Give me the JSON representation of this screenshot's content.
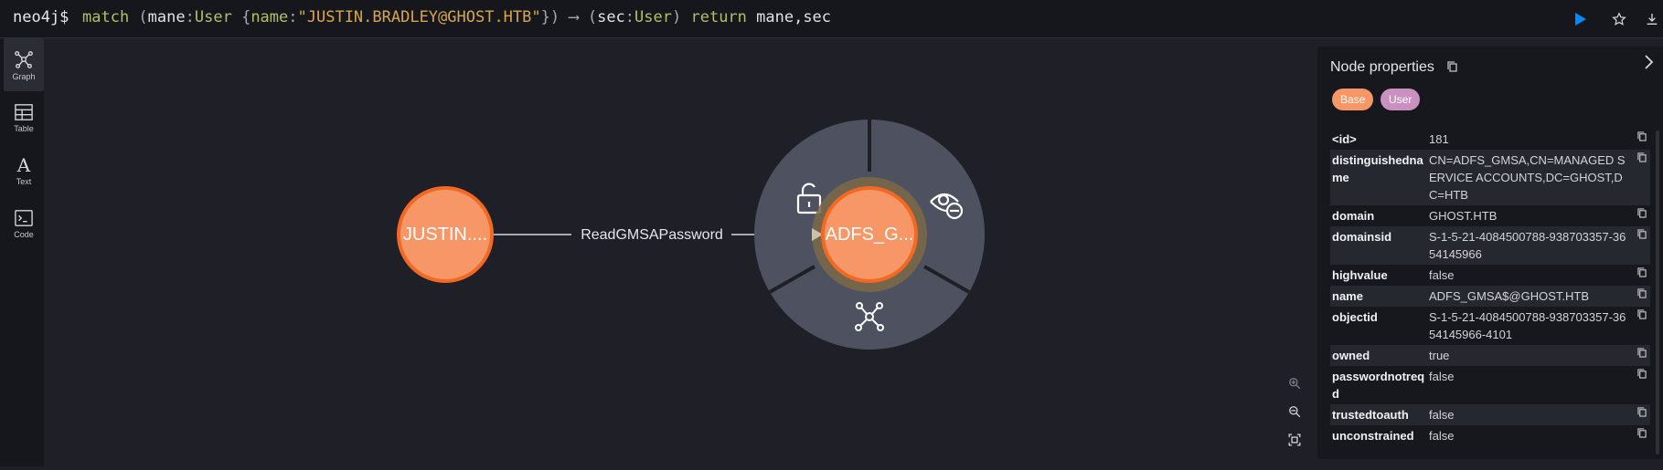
{
  "query": {
    "prompt": "neo4j$",
    "tokens": [
      {
        "t": "match",
        "c": "kw"
      },
      {
        "t": " (",
        "c": "punct"
      },
      {
        "t": "mane",
        "c": "plain"
      },
      {
        "t": ":",
        "c": "punct"
      },
      {
        "t": "User",
        "c": "lbl"
      },
      {
        "t": " {",
        "c": "punct"
      },
      {
        "t": "name",
        "c": "lbl"
      },
      {
        "t": ":",
        "c": "punct"
      },
      {
        "t": "\"JUSTIN.BRADLEY@GHOST.HTB\"",
        "c": "str"
      },
      {
        "t": "}) ",
        "c": "punct"
      },
      {
        "t": "⟶",
        "c": "punct"
      },
      {
        "t": " (",
        "c": "punct"
      },
      {
        "t": "sec",
        "c": "plain"
      },
      {
        "t": ":",
        "c": "punct"
      },
      {
        "t": "User",
        "c": "lbl"
      },
      {
        "t": ") ",
        "c": "punct"
      },
      {
        "t": "return",
        "c": "kw"
      },
      {
        "t": " mane,sec",
        "c": "plain"
      }
    ]
  },
  "sidebar": {
    "items": [
      {
        "label": "Graph",
        "icon": "graph-icon",
        "active": true
      },
      {
        "label": "Table",
        "icon": "table-icon",
        "active": false
      },
      {
        "label": "Text",
        "icon": "text-icon",
        "active": false
      },
      {
        "label": "Code",
        "icon": "code-icon",
        "active": false
      }
    ]
  },
  "graph": {
    "source_node": "JUSTIN....",
    "target_node": "ADFS_G...",
    "relationship": "ReadGMSAPassword",
    "ring_actions": [
      "unlock-icon",
      "hide-icon",
      "expand-icon"
    ]
  },
  "panel": {
    "title": "Node properties",
    "labels": [
      {
        "text": "Base",
        "color": "#f79767"
      },
      {
        "text": "User",
        "color": "#c990c0"
      }
    ],
    "properties": [
      {
        "key": "<id>",
        "value": "181"
      },
      {
        "key": "distinguishedname",
        "value": "CN=ADFS_GMSA,CN=MANAGED SERVICE ACCOUNTS,DC=GHOST,DC=HTB"
      },
      {
        "key": "domain",
        "value": "GHOST.HTB"
      },
      {
        "key": "domainsid",
        "value": "S-1-5-21-4084500788-938703357-3654145966"
      },
      {
        "key": "highvalue",
        "value": "false"
      },
      {
        "key": "name",
        "value": "ADFS_GMSA$@GHOST.HTB"
      },
      {
        "key": "objectid",
        "value": "S-1-5-21-4084500788-938703357-3654145966-4101"
      },
      {
        "key": "owned",
        "value": "true"
      },
      {
        "key": "passwordnotreqd",
        "value": "false"
      },
      {
        "key": "trustedtoauth",
        "value": "false"
      },
      {
        "key": "unconstrained",
        "value": "false"
      }
    ]
  },
  "colors": {
    "node_fill": "#f79767",
    "node_stroke": "#f36924",
    "ring": "#4e5260",
    "accent": "#018bff"
  }
}
